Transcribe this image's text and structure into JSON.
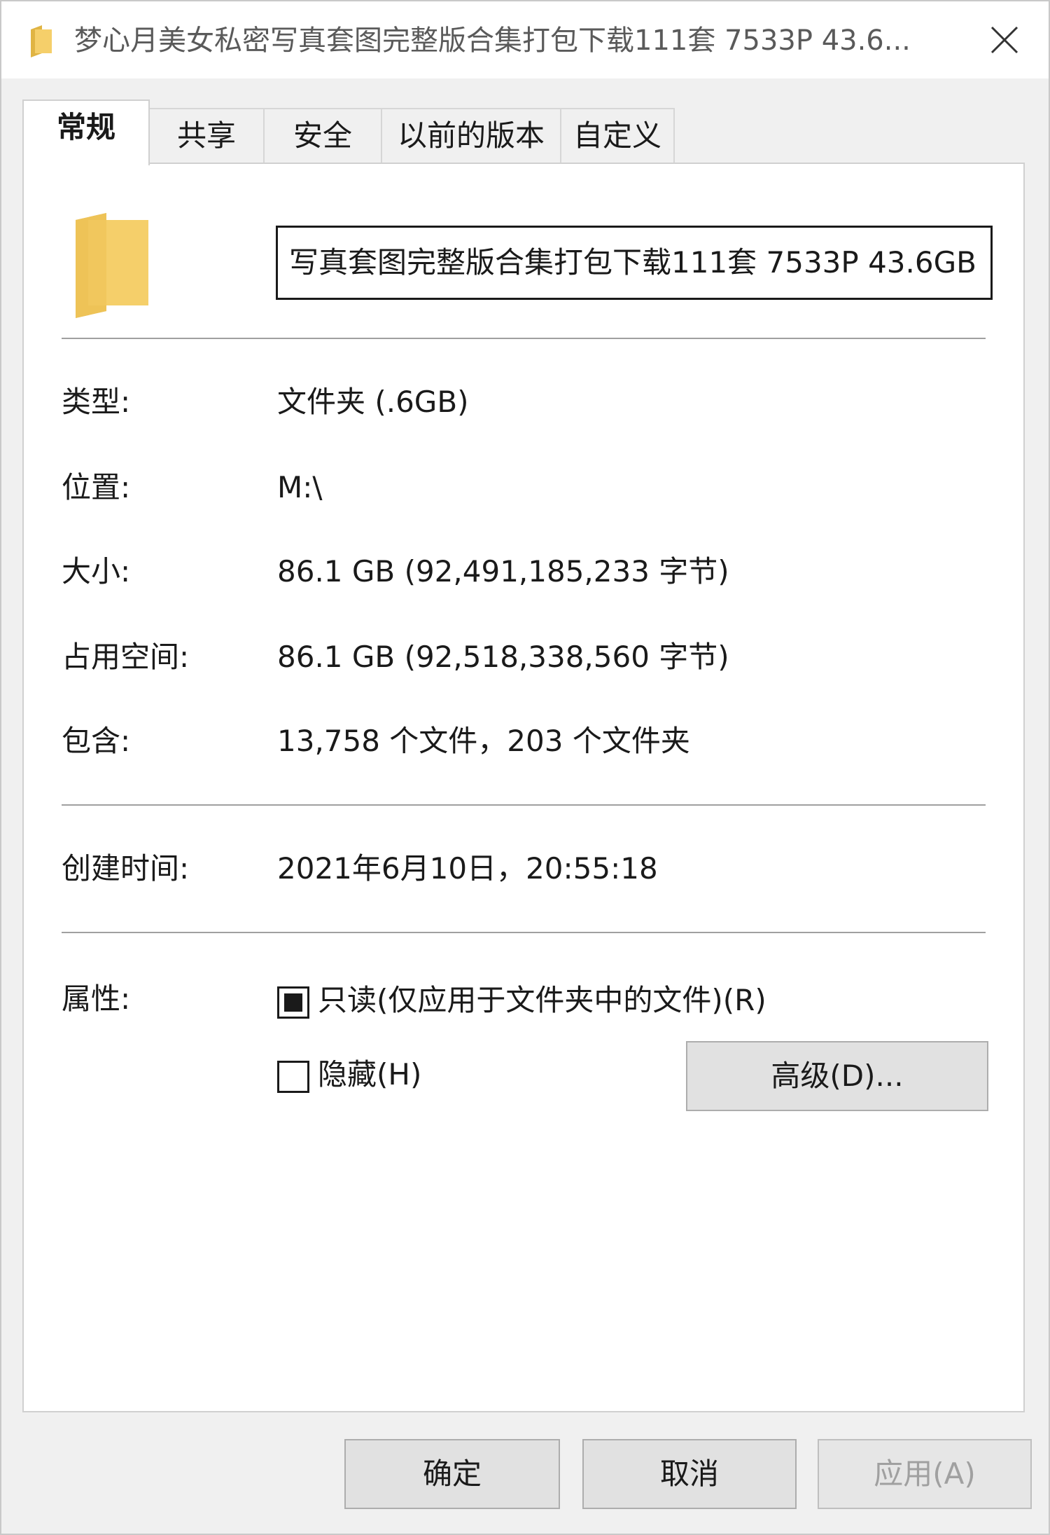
{
  "window": {
    "title": "梦心月美女私密写真套图完整版合集打包下载111套 7533P 43.6...",
    "folder_icon": "folder-icon",
    "close_icon": "close-icon"
  },
  "tabs": [
    {
      "label": "常规",
      "active": true
    },
    {
      "label": "共享",
      "active": false
    },
    {
      "label": "安全",
      "active": false
    },
    {
      "label": "以前的版本",
      "active": false
    },
    {
      "label": "自定义",
      "active": false
    }
  ],
  "general": {
    "name_value": "梦心月美女私密写真套图完整版合集打包下载111套 7533P 43.6GB",
    "name_visible": "写真套图完整版合集打包下载111套 7533P 43.6GB",
    "rows": [
      {
        "label": "类型:",
        "value": "文件夹 (.6GB)"
      },
      {
        "label": "位置:",
        "value": "M:\\"
      },
      {
        "label": "大小:",
        "value": "86.1 GB (92,491,185,233 字节)"
      },
      {
        "label": "占用空间:",
        "value": "86.1 GB (92,518,338,560 字节)"
      },
      {
        "label": "包含:",
        "value": "13,758 个文件，203 个文件夹"
      }
    ],
    "created_label": "创建时间:",
    "created_value": "2021年6月10日，20:55:18",
    "attributes_label": "属性:",
    "readonly_label": "只读(仅应用于文件夹中的文件)(R)",
    "readonly_state": "indeterminate",
    "hidden_label": "隐藏(H)",
    "hidden_state": "unchecked",
    "advanced_label": "高级(D)..."
  },
  "footer": {
    "ok_label": "确定",
    "cancel_label": "取消",
    "apply_label": "应用(A)",
    "apply_disabled": true
  },
  "colors": {
    "folder": "#f5cf6a",
    "folder_dark": "#e0b443",
    "panel": "#ffffff",
    "chrome": "#f0f0f0"
  }
}
